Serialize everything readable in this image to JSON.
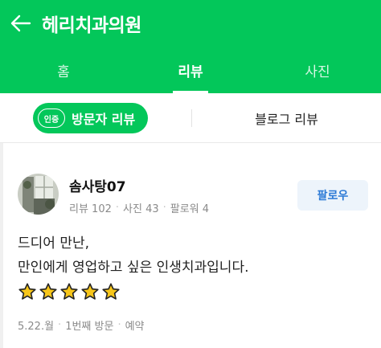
{
  "header": {
    "title": "헤리치과의원",
    "back_icon": "arrow-left-icon"
  },
  "tabs": [
    {
      "label": "홈",
      "active": false
    },
    {
      "label": "리뷰",
      "active": true
    },
    {
      "label": "사진",
      "active": false
    }
  ],
  "subtabs": {
    "visitor_badge": "인증",
    "visitor_label": "방문자 리뷰",
    "blog_label": "블로그 리뷰"
  },
  "review": {
    "nickname": "솜사탕07",
    "stats": {
      "reviews": "리뷰 102",
      "photos": "사진 43",
      "followers": "팔로워 4"
    },
    "follow_label": "팔로우",
    "text_line1": "드디어 만난,",
    "text_line2": "만인에게 영업하고 싶은 인생치과입니다.",
    "stars": 5,
    "star_icon": "star-icon",
    "meta": {
      "date": "5.22.월",
      "visit_count": "1번째 방문",
      "type": "예약"
    }
  },
  "colors": {
    "brand": "#03c75a",
    "follow_text": "#2c7ad6",
    "follow_bg": "#edf4fb",
    "star_fill": "#f7c61a",
    "star_stroke": "#222222"
  }
}
